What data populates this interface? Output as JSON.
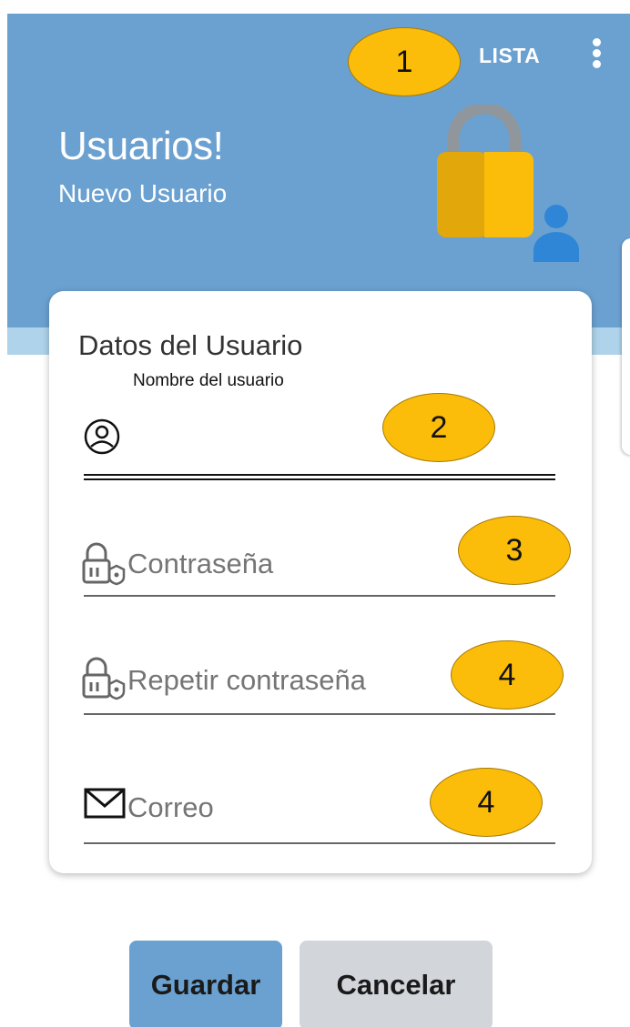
{
  "appbar": {
    "action_label": "LISTA",
    "overflow_icon": "more-vert-icon",
    "background_color": "#6ba1d1"
  },
  "header": {
    "title": "Usuarios!",
    "subtitle": "Nuevo Usuario",
    "illustration": "lock-user-icon"
  },
  "form": {
    "section_title": "Datos del Usuario",
    "fields": {
      "username": {
        "label": "Nombre del usuario",
        "value": "",
        "icon": "user-circle-icon"
      },
      "password": {
        "placeholder": "Contraseña",
        "icon": "padlock-icon"
      },
      "repeat_password": {
        "placeholder": "Repetir contraseña",
        "icon": "padlock-icon"
      },
      "email": {
        "placeholder": "Correo",
        "icon": "envelope-icon"
      }
    }
  },
  "annotations": {
    "badge_1": "1",
    "badge_2": "2",
    "badge_3": "3",
    "badge_4a": "4",
    "badge_4b": "4",
    "color": "#fbbd09"
  },
  "buttons": {
    "save_label": "Guardar",
    "cancel_label": "Cancelar",
    "save_color": "#6ba1d1",
    "cancel_color": "#d2d6db"
  }
}
